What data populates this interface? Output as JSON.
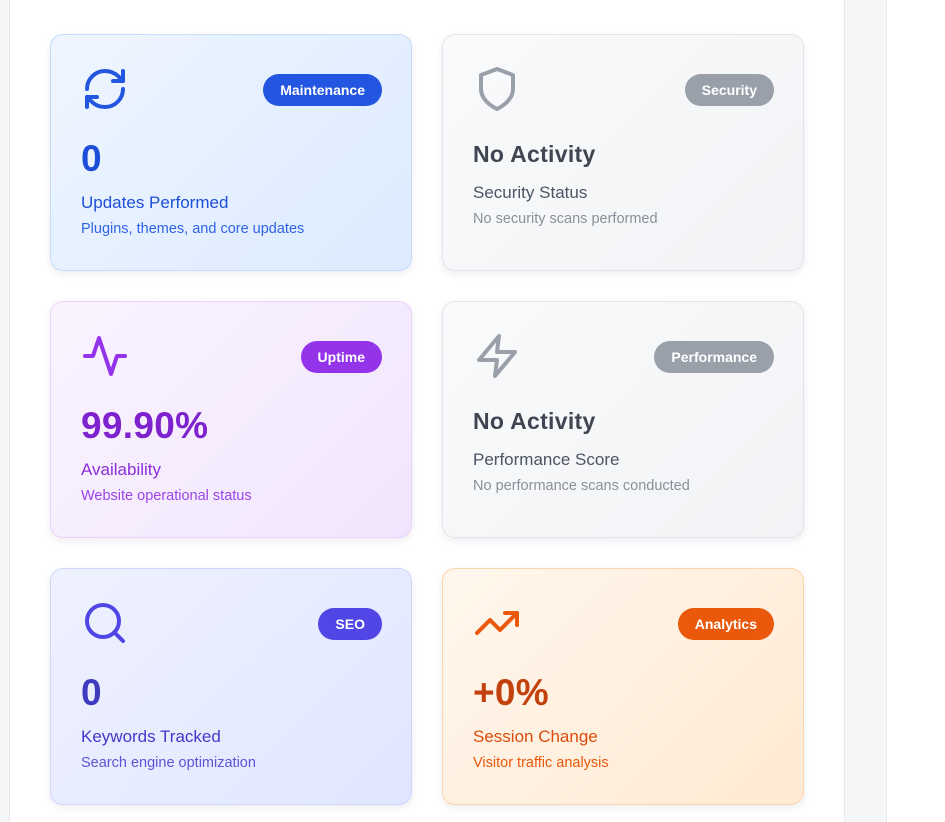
{
  "colors": {
    "maintenance_badge": "#2356e0",
    "maintenance_text": "#1d4ed8",
    "gray_badge": "#9aa0aa",
    "gray_title": "#3f4652",
    "gray_label": "#4b5563",
    "gray_sub": "#8a909b",
    "uptime_badge": "#9333ea",
    "uptime_text": "#7e22ce",
    "seo_badge": "#4f46e5",
    "seo_text": "#3f3bbf",
    "analytics_badge": "#ea580c",
    "analytics_text": "#c2410c"
  },
  "cards": [
    {
      "id": "maintenance",
      "icon": "refresh-icon",
      "badge": "Maintenance",
      "value": "0",
      "label": "Updates Performed",
      "sub": "Plugins, themes, and core updates"
    },
    {
      "id": "security",
      "icon": "shield-icon",
      "badge": "Security",
      "value": "No Activity",
      "label": "Security Status",
      "sub": "No security scans performed"
    },
    {
      "id": "uptime",
      "icon": "activity-icon",
      "badge": "Uptime",
      "value": "99.90%",
      "label": "Availability",
      "sub": "Website operational status"
    },
    {
      "id": "performance",
      "icon": "lightning-icon",
      "badge": "Performance",
      "value": "No Activity",
      "label": "Performance Score",
      "sub": "No performance scans conducted"
    },
    {
      "id": "seo",
      "icon": "search-icon",
      "badge": "SEO",
      "value": "0",
      "label": "Keywords Tracked",
      "sub": "Search engine optimization"
    },
    {
      "id": "analytics",
      "icon": "trending-up-icon",
      "badge": "Analytics",
      "value": "+0%",
      "label": "Session Change",
      "sub": "Visitor traffic analysis"
    }
  ]
}
